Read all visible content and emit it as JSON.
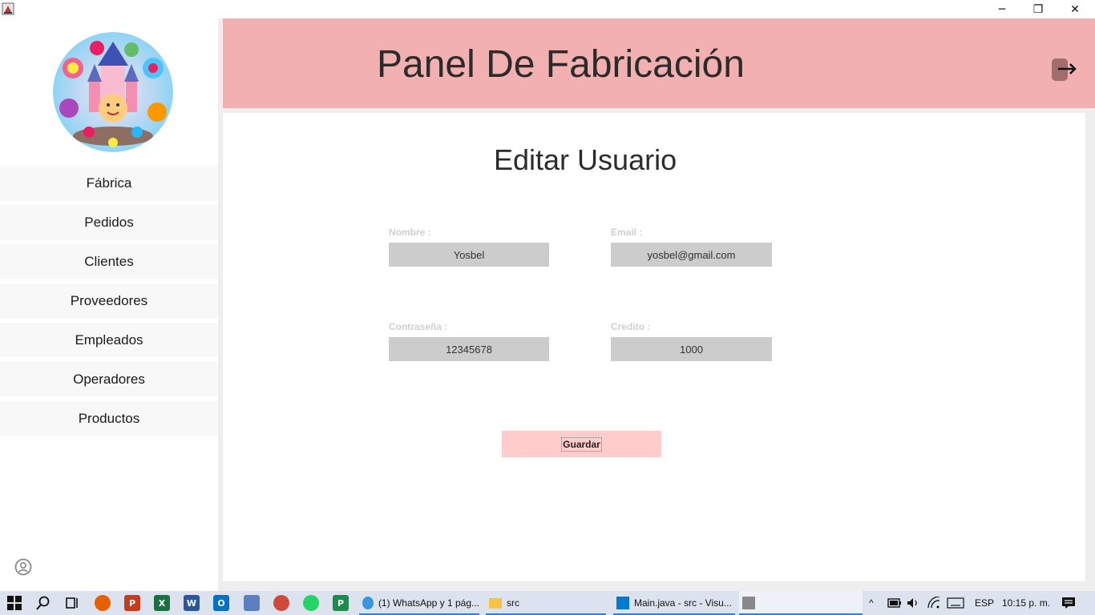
{
  "window": {
    "minimize_glyph": "─",
    "maximize_glyph": "❐",
    "close_glyph": "✕"
  },
  "header": {
    "title": "Panel De Fabricación"
  },
  "sidebar": {
    "items": [
      {
        "label": "Fábrica"
      },
      {
        "label": "Pedidos"
      },
      {
        "label": "Clientes"
      },
      {
        "label": "Proveedores"
      },
      {
        "label": "Empleados"
      },
      {
        "label": "Operadores"
      },
      {
        "label": "Productos"
      }
    ]
  },
  "form": {
    "title": "Editar Usuario",
    "nombre": {
      "label": "Nombre :",
      "value": "Yosbel"
    },
    "email": {
      "label": "Email :",
      "value": "yosbel@gmail.com"
    },
    "password": {
      "label": "Contraseña :",
      "value": "12345678"
    },
    "credito": {
      "label": "Credito :",
      "value": "1000"
    },
    "save_label": "Guardar"
  },
  "taskbar": {
    "tasks": [
      {
        "label": "(1) WhatsApp y 1 pág..."
      },
      {
        "label": "src"
      },
      {
        "label": "Main.java - src - Visu..."
      }
    ],
    "language": "ESP",
    "clock": "10:15 p. m."
  },
  "colors": {
    "header_bg": "#f2b0b0",
    "save_button_bg": "#ffcccc",
    "input_bg": "#cccccc"
  }
}
